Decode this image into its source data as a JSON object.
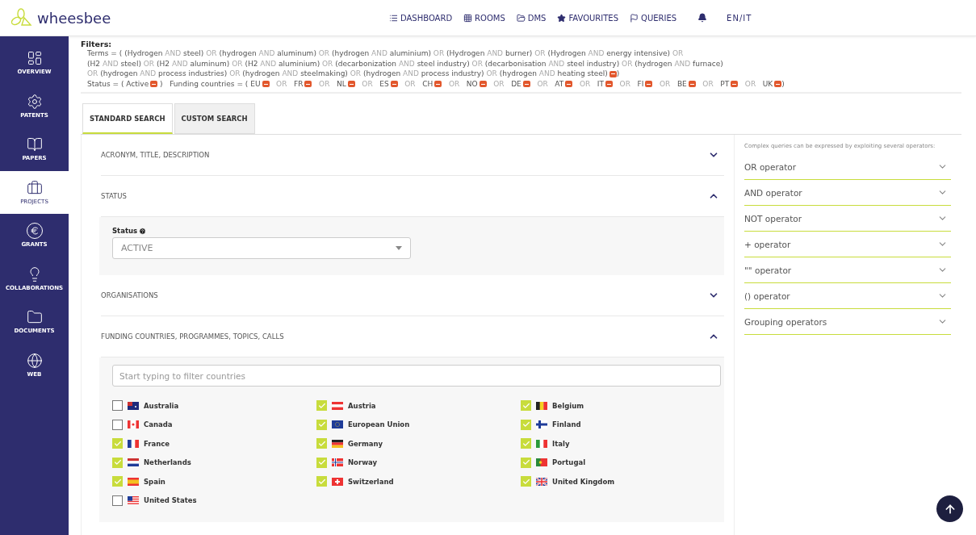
{
  "header": {
    "logo": "wheesbee",
    "nav": [
      "DASHBOARD",
      "ROOMS",
      "DMS",
      "FAVOURITES",
      "QUERIES"
    ],
    "language": "EN/IT"
  },
  "sidebar": {
    "items": [
      {
        "label": "OVERVIEW",
        "selected": false
      },
      {
        "label": "PATENTS",
        "selected": false
      },
      {
        "label": "PAPERS",
        "selected": false
      },
      {
        "label": "PROJECTS",
        "selected": true
      },
      {
        "label": "GRANTS",
        "selected": false
      },
      {
        "label": "COLLABORATIONS",
        "selected": false
      },
      {
        "label": "DOCUMENTS",
        "selected": false
      },
      {
        "label": "WEB",
        "selected": false
      }
    ]
  },
  "filters": {
    "title": "Filters:",
    "terms_label": "Terms = (",
    "terms": [
      {
        "left": "(Hydrogen",
        "op": "AND",
        "right": "steel)",
        "joiner": "OR"
      },
      {
        "left": "(hydrogen",
        "op": "AND",
        "right": "aluminum)",
        "joiner": "OR"
      },
      {
        "left": "(hydrogen",
        "op": "AND",
        "right": "aluminium)",
        "joiner": "OR"
      },
      {
        "left": "(Hydrogen",
        "op": "AND",
        "right": "burner)",
        "joiner": "OR"
      },
      {
        "left": "(Hydrogen",
        "op": "AND",
        "right": "energy intensive)",
        "joiner": "OR"
      },
      {
        "left": "(H2",
        "op": "AND",
        "right": "steel)",
        "joiner": "OR"
      },
      {
        "left": "(H2",
        "op": "AND",
        "right": "aluminum)",
        "joiner": "OR"
      },
      {
        "left": "(H2",
        "op": "AND",
        "right": "aluminium)",
        "joiner": "OR"
      },
      {
        "left": "(decarbonization",
        "op": "AND",
        "right": "steel industry)",
        "joiner": "OR"
      },
      {
        "left": "(decarbonisation",
        "op": "AND",
        "right": "steel industry)",
        "joiner": "OR"
      },
      {
        "left": "(hydrogen",
        "op": "AND",
        "right": "furnace)",
        "joiner": "OR"
      },
      {
        "left": "(hydrogen",
        "op": "AND",
        "right": "process industries)",
        "joiner": "OR"
      },
      {
        "left": "(hydrogen",
        "op": "AND",
        "right": "steelmaking)",
        "joiner": "OR"
      },
      {
        "left": "(hydrogen",
        "op": "AND",
        "right": "process industry)",
        "joiner": "OR"
      },
      {
        "left": "(hydrogen",
        "op": "AND",
        "right": "heating steel)"
      }
    ],
    "terms_close": ")",
    "status_label": "Status = (",
    "status": [
      "Active"
    ],
    "status_close": ")",
    "countries_label": "Funding countries = (",
    "countries": [
      {
        "code": "EU",
        "joiner": "OR"
      },
      {
        "code": "FR",
        "joiner": "OR"
      },
      {
        "code": "NL",
        "joiner": "OR"
      },
      {
        "code": "ES",
        "joiner": "OR"
      },
      {
        "code": "CH",
        "joiner": "OR"
      },
      {
        "code": "NO",
        "joiner": "OR"
      },
      {
        "code": "DE",
        "joiner": "OR"
      },
      {
        "code": "AT",
        "joiner": "OR"
      },
      {
        "code": "IT",
        "joiner": "OR"
      },
      {
        "code": "FI",
        "joiner": "OR"
      },
      {
        "code": "BE",
        "joiner": "OR"
      },
      {
        "code": "PT",
        "joiner": "OR"
      },
      {
        "code": "UK"
      }
    ],
    "countries_close": ")"
  },
  "tabs": [
    {
      "label": "STANDARD SEARCH",
      "selected": true
    },
    {
      "label": "CUSTOM SEARCH",
      "selected": false
    }
  ],
  "sections": [
    {
      "title": "ACRONYM, TITLE, DESCRIPTION",
      "expanded": false
    },
    {
      "title": "STATUS",
      "expanded": true,
      "field_label": "Status",
      "value": "ACTIVE"
    },
    {
      "title": "ORGANISATIONS",
      "expanded": false
    },
    {
      "title": "FUNDING COUNTRIES, PROGRAMMES, TOPICS, CALLS",
      "expanded": true,
      "placeholder": "Start typing to filter countries",
      "countries": [
        {
          "name": "Australia",
          "checked": false
        },
        {
          "name": "Austria",
          "checked": true
        },
        {
          "name": "Belgium",
          "checked": true
        },
        {
          "name": "Canada",
          "checked": false
        },
        {
          "name": "European Union",
          "checked": true
        },
        {
          "name": "Finland",
          "checked": true
        },
        {
          "name": "France",
          "checked": true
        },
        {
          "name": "Germany",
          "checked": true
        },
        {
          "name": "Italy",
          "checked": true
        },
        {
          "name": "Netherlands",
          "checked": true
        },
        {
          "name": "Norway",
          "checked": true
        },
        {
          "name": "Portugal",
          "checked": true
        },
        {
          "name": "Spain",
          "checked": true
        },
        {
          "name": "Switzerland",
          "checked": true
        },
        {
          "name": "United Kingdom",
          "checked": true
        },
        {
          "name": "United States",
          "checked": false
        }
      ]
    }
  ],
  "help": {
    "intro": "Complex queries can be expressed by exploiting several operators:",
    "operators": [
      {
        "label": "OR operator",
        "expanded": false
      },
      {
        "label": "AND operator",
        "expanded": false
      },
      {
        "label": "NOT operator",
        "expanded": false
      },
      {
        "label": "+ operator",
        "expanded": false
      },
      {
        "label": "\"\" operator",
        "expanded": false
      },
      {
        "label": "() operator",
        "expanded": false
      },
      {
        "label": "Grouping operators",
        "expanded": false
      }
    ]
  }
}
